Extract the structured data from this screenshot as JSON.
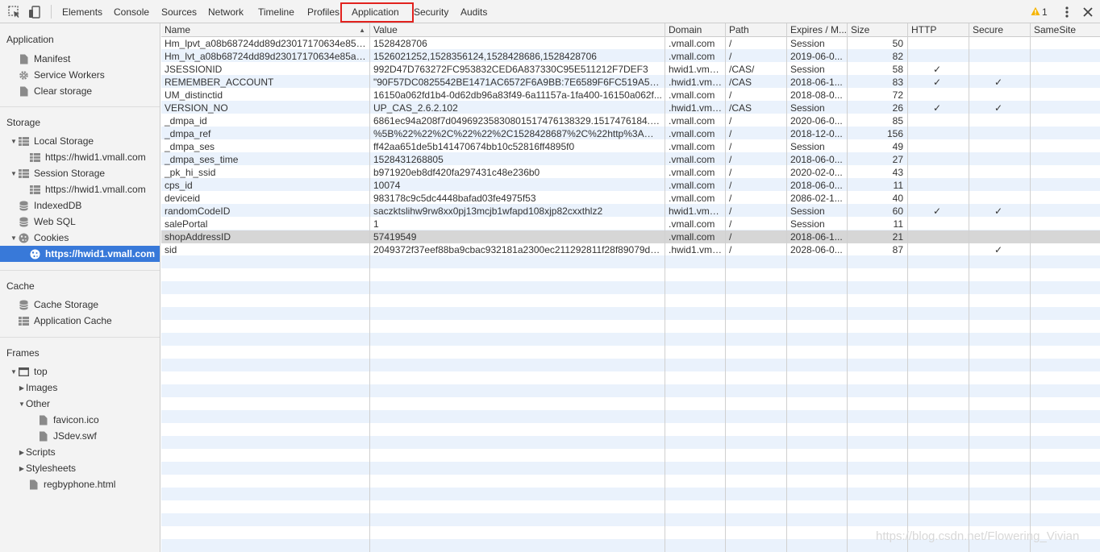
{
  "toolbar": {
    "tabs": [
      {
        "label": "Elements"
      },
      {
        "label": "Console"
      },
      {
        "label": "Sources"
      },
      {
        "label": "Network"
      },
      {
        "label": "Timeline"
      },
      {
        "label": "Profiles"
      },
      {
        "label": "Application"
      },
      {
        "label": "Security"
      },
      {
        "label": "Audits"
      }
    ],
    "active_tab": "Application",
    "warning_count": "1",
    "icons": [
      "inspect-element-icon",
      "device-mode-icon",
      "warning-icon",
      "more-menu-icon",
      "close-icon"
    ]
  },
  "sidebar": {
    "application": {
      "heading": "Application",
      "items": [
        {
          "label": "Manifest",
          "icon": "document-icon"
        },
        {
          "label": "Service Workers",
          "icon": "gear-icon"
        },
        {
          "label": "Clear storage",
          "icon": "document-icon"
        }
      ]
    },
    "storage": {
      "heading": "Storage",
      "local_storage": {
        "label": "Local Storage",
        "child": "https://hwid1.vmall.com"
      },
      "session_storage": {
        "label": "Session Storage",
        "child": "https://hwid1.vmall.com"
      },
      "indexeddb": "IndexedDB",
      "websql": "Web SQL",
      "cookies": {
        "label": "Cookies",
        "child": "https://hwid1.vmall.com"
      }
    },
    "cache": {
      "heading": "Cache",
      "items": [
        {
          "label": "Cache Storage"
        },
        {
          "label": "Application Cache"
        }
      ]
    },
    "frames": {
      "heading": "Frames",
      "top": "top",
      "images": "Images",
      "other": "Other",
      "other_children": [
        "favicon.ico",
        "JSdev.swf"
      ],
      "scripts": "Scripts",
      "stylesheets": "Stylesheets",
      "page": "regbyphone.html"
    }
  },
  "cookies_table": {
    "columns": [
      "Name",
      "Value",
      "Domain",
      "Path",
      "Expires / M...",
      "Size",
      "HTTP",
      "Secure",
      "SameSite"
    ],
    "check_mark": "✓",
    "rows": [
      {
        "name": "Hm_lpvt_a08b68724dd89d23017170634e85ac...",
        "value": "1528428706",
        "domain": ".vmall.com",
        "path": "/",
        "expires": "Session",
        "size": "50",
        "http": false,
        "secure": false
      },
      {
        "name": "Hm_lvt_a08b68724dd89d23017170634e85acd8",
        "value": "1526021252,1528356124,1528428686,1528428706",
        "domain": ".vmall.com",
        "path": "/",
        "expires": "2019-06-0...",
        "size": "82",
        "http": false,
        "secure": false
      },
      {
        "name": "JSESSIONID",
        "value": "992D47D763272FC953832CED6A837330C95E511212F7DEF3",
        "domain": "hwid1.vma...",
        "path": "/CAS/",
        "expires": "Session",
        "size": "58",
        "http": true,
        "secure": false
      },
      {
        "name": "REMEMBER_ACCOUNT",
        "value": "\"90F57DC0825542BE1471AC6572F6A9BB:7E6589F6FC519A5531FF...",
        "domain": ".hwid1.vma...",
        "path": "/CAS",
        "expires": "2018-06-1...",
        "size": "83",
        "http": true,
        "secure": true
      },
      {
        "name": "UM_distinctid",
        "value": "16150a062fd1b4-0d62db96a83f49-6a11157a-1fa400-16150a062f...",
        "domain": ".vmall.com",
        "path": "/",
        "expires": "2018-08-0...",
        "size": "72",
        "http": false,
        "secure": false
      },
      {
        "name": "VERSION_NO",
        "value": "UP_CAS_2.6.2.102",
        "domain": ".hwid1.vma...",
        "path": "/CAS",
        "expires": "Session",
        "size": "26",
        "http": true,
        "secure": true
      },
      {
        "name": "_dmpa_id",
        "value": "6861ec94a208f7d0496923583080151747613832​9.1517476184.4.1...",
        "domain": ".vmall.com",
        "path": "/",
        "expires": "2020-06-0...",
        "size": "85",
        "http": false,
        "secure": false
      },
      {
        "name": "_dmpa_ref",
        "value": "%5B%22%22%2C%22%22%2C1528428687%2C%22http%3A%2F%...",
        "domain": ".vmall.com",
        "path": "/",
        "expires": "2018-12-0...",
        "size": "156",
        "http": false,
        "secure": false
      },
      {
        "name": "_dmpa_ses",
        "value": "ff42aa651de5b141470674bb10c52816ff4895f0",
        "domain": ".vmall.com",
        "path": "/",
        "expires": "Session",
        "size": "49",
        "http": false,
        "secure": false
      },
      {
        "name": "_dmpa_ses_time",
        "value": "1528431268805",
        "domain": ".vmall.com",
        "path": "/",
        "expires": "2018-06-0...",
        "size": "27",
        "http": false,
        "secure": false
      },
      {
        "name": "_pk_hi_ssid",
        "value": "b971920eb8df420fa297431c48e236b0",
        "domain": ".vmall.com",
        "path": "/",
        "expires": "2020-02-0...",
        "size": "43",
        "http": false,
        "secure": false
      },
      {
        "name": "cps_id",
        "value": "10074",
        "domain": ".vmall.com",
        "path": "/",
        "expires": "2018-06-0...",
        "size": "11",
        "http": false,
        "secure": false
      },
      {
        "name": "deviceid",
        "value": "983178c9c5dc4448bafad03fe4975f53",
        "domain": ".vmall.com",
        "path": "/",
        "expires": "2086-02-1...",
        "size": "40",
        "http": false,
        "secure": false
      },
      {
        "name": "randomCodeID",
        "value": "saczktslihw9rw8xx0pj13mcjb1wfapd108xjp82cxxthlz2",
        "domain": "hwid1.vma...",
        "path": "/",
        "expires": "Session",
        "size": "60",
        "http": true,
        "secure": true
      },
      {
        "name": "salePortal",
        "value": "1",
        "domain": ".vmall.com",
        "path": "/",
        "expires": "Session",
        "size": "11",
        "http": false,
        "secure": false
      },
      {
        "name": "shopAddressID",
        "value": "57419549",
        "domain": ".vmall.com",
        "path": "/",
        "expires": "2018-06-1...",
        "size": "21",
        "http": false,
        "secure": false
      },
      {
        "name": "sid",
        "value": "2049372f37eef88ba9cbac932181a2300ec211292811f28f89079d6c...",
        "domain": ".hwid1.vma...",
        "path": "/",
        "expires": "2028-06-0...",
        "size": "87",
        "http": false,
        "secure": true
      }
    ],
    "selected_row": "shopAddressID"
  },
  "watermark": "https://blog.csdn.net/Flowering_Vivian",
  "colors": {
    "selection": "#3879d9",
    "row_stripe": "#eaf2fc",
    "highlight_box": "#e2221e",
    "warning": "#f5b400"
  }
}
